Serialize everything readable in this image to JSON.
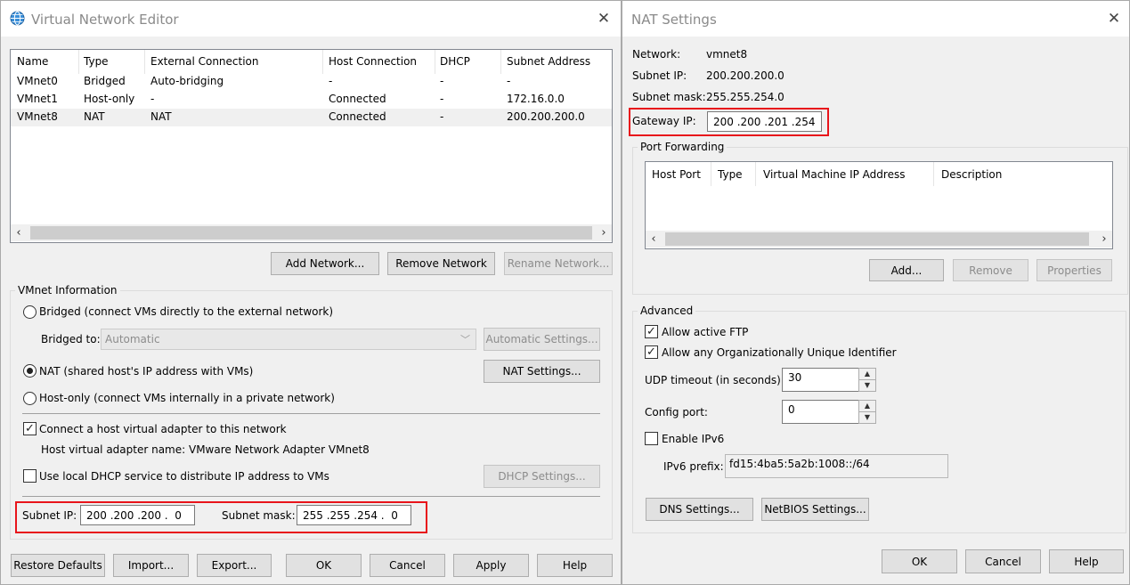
{
  "vne": {
    "title": "Virtual Network Editor",
    "table": {
      "headers": [
        "Name",
        "Type",
        "External Connection",
        "Host Connection",
        "DHCP",
        "Subnet Address"
      ],
      "rows": [
        [
          "VMnet0",
          "Bridged",
          "Auto-bridging",
          "-",
          "-",
          "-"
        ],
        [
          "VMnet1",
          "Host-only",
          "-",
          "Connected",
          "-",
          "172.16.0.0"
        ],
        [
          "VMnet8",
          "NAT",
          "NAT",
          "Connected",
          "-",
          "200.200.200.0"
        ]
      ]
    },
    "buttons": {
      "add_network": "Add Network...",
      "remove_network": "Remove Network",
      "rename_network": "Rename Network...",
      "automatic_settings": "Automatic Settings...",
      "nat_settings": "NAT Settings...",
      "dhcp_settings": "DHCP Settings...",
      "restore_defaults": "Restore Defaults",
      "import": "Import...",
      "export": "Export...",
      "ok": "OK",
      "cancel": "Cancel",
      "apply": "Apply",
      "help": "Help"
    },
    "info": {
      "group_label": "VMnet Information",
      "bridged_label": "Bridged (connect VMs directly to the external network)",
      "bridged_to_label": "Bridged to:",
      "bridged_to_value": "Automatic",
      "nat_label": "NAT (shared host's IP address with VMs)",
      "hostonly_label": "Host-only (connect VMs internally in a private network)",
      "connect_adapter_label": "Connect a host virtual adapter to this network",
      "adapter_name_label": "Host virtual adapter name: VMware Network Adapter VMnet8",
      "dhcp_label": "Use local DHCP service to distribute IP address to VMs",
      "subnet_ip_label": "Subnet IP:",
      "subnet_ip_value": "200 .200 .200 .  0",
      "subnet_mask_label": "Subnet mask:",
      "subnet_mask_value": "255 .255 .254 .  0",
      "selected_mode": "nat",
      "connect_adapter_checked": true,
      "dhcp_checked": false
    }
  },
  "nat": {
    "title": "NAT Settings",
    "network_label": "Network:",
    "network_value": "vmnet8",
    "subnet_ip_label": "Subnet IP:",
    "subnet_ip_value": "200.200.200.0",
    "subnet_mask_label": "Subnet mask:",
    "subnet_mask_value": "255.255.254.0",
    "gateway_label": "Gateway IP:",
    "gateway_value": "200 .200 .201 .254",
    "port_forwarding": {
      "label": "Port Forwarding",
      "headers": [
        "Host Port",
        "Type",
        "Virtual Machine IP Address",
        "Description"
      ],
      "add": "Add...",
      "remove": "Remove",
      "properties": "Properties"
    },
    "advanced": {
      "label": "Advanced",
      "allow_ftp": "Allow active FTP",
      "allow_oui": "Allow any Organizationally Unique Identifier",
      "udp_timeout_label": "UDP timeout (in seconds):",
      "udp_timeout_value": "30",
      "config_port_label": "Config port:",
      "config_port_value": "0",
      "enable_ipv6": "Enable IPv6",
      "ipv6_prefix_label": "IPv6 prefix:",
      "ipv6_prefix_value": "fd15:4ba5:5a2b:1008::/64",
      "dns_settings": "DNS Settings...",
      "netbios_settings": "NetBIOS Settings...",
      "allow_ftp_checked": true,
      "allow_oui_checked": true,
      "enable_ipv6_checked": false
    },
    "buttons": {
      "ok": "OK",
      "cancel": "Cancel",
      "help": "Help"
    }
  },
  "icons": {
    "app": "globe-icon",
    "close": "close-icon",
    "check": "check-mark-icon"
  },
  "colors": {
    "highlight": "#e8141b",
    "window_bg": "#f0f0f0",
    "selected_row": "#f0f0f0"
  }
}
